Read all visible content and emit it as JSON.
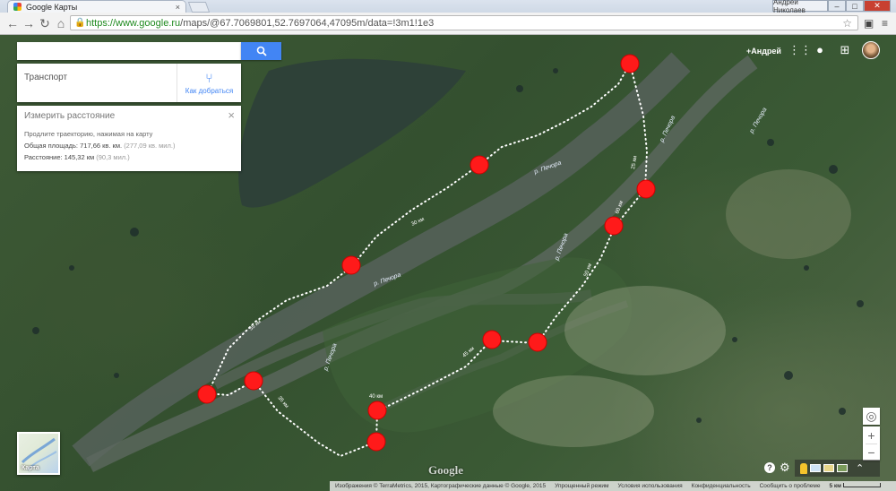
{
  "browser": {
    "tab_title": "Google Карты",
    "tab_close": "×",
    "user_name": "Андрей Николаев",
    "minimize": "–",
    "maximize": "□",
    "close": "✕",
    "back_icon": "arrow-left",
    "forward_icon": "arrow-right",
    "reload_icon": "reload",
    "home_icon": "home",
    "url_host": "https://www.google.ru",
    "url_path": "/maps/@67.7069801,52.7697064,47095m/data=!3m1!1e3",
    "bookmark_icon": "star"
  },
  "search": {
    "value": "",
    "placeholder": "",
    "button_icon": "search"
  },
  "transport": {
    "label": "Транспорт",
    "directions_label": "Как добраться"
  },
  "measure": {
    "title": "Измерить расстояние",
    "close": "×",
    "hint": "Продлите траекторию, нажимая на карту",
    "area_label": "Общая площадь: 717,66 кв. км.",
    "area_alt": "(277,09 кв. мил.)",
    "distance_label": "Расстояние: 145,32 км",
    "distance_alt": "(90,3 мил.)"
  },
  "account": {
    "name": "+Андрей",
    "apps_icon": "grid",
    "notifications_icon": "bell",
    "share_icon": "plus-square"
  },
  "map": {
    "river_labels": [
      "р. Печора",
      "р. Печора",
      "р. Печора",
      "р. Печора",
      "р. Печора",
      "р. Печора"
    ],
    "distance_labels": [
      "25 км",
      "30 км",
      "35 км",
      "40 км",
      "45 км",
      "50 км",
      "55 км",
      "60 км"
    ],
    "marker_color": "#ff1a1a",
    "path_color": "#ffffff",
    "thumbnail_label": "Карта",
    "watermark": "Google"
  },
  "controls": {
    "locate": "◎",
    "zoom_in": "+",
    "zoom_out": "−",
    "help": "?",
    "settings_icon": "gear",
    "expand": "⌃"
  },
  "footer": {
    "imagery": "Изображения © TerraMetrics, 2015, Картографические данные © Google, 2015",
    "lite": "Упрощенный режим",
    "terms": "Условия использования",
    "privacy": "Конфиденциальность",
    "report": "Сообщить о проблеме",
    "scale": "5 км"
  }
}
